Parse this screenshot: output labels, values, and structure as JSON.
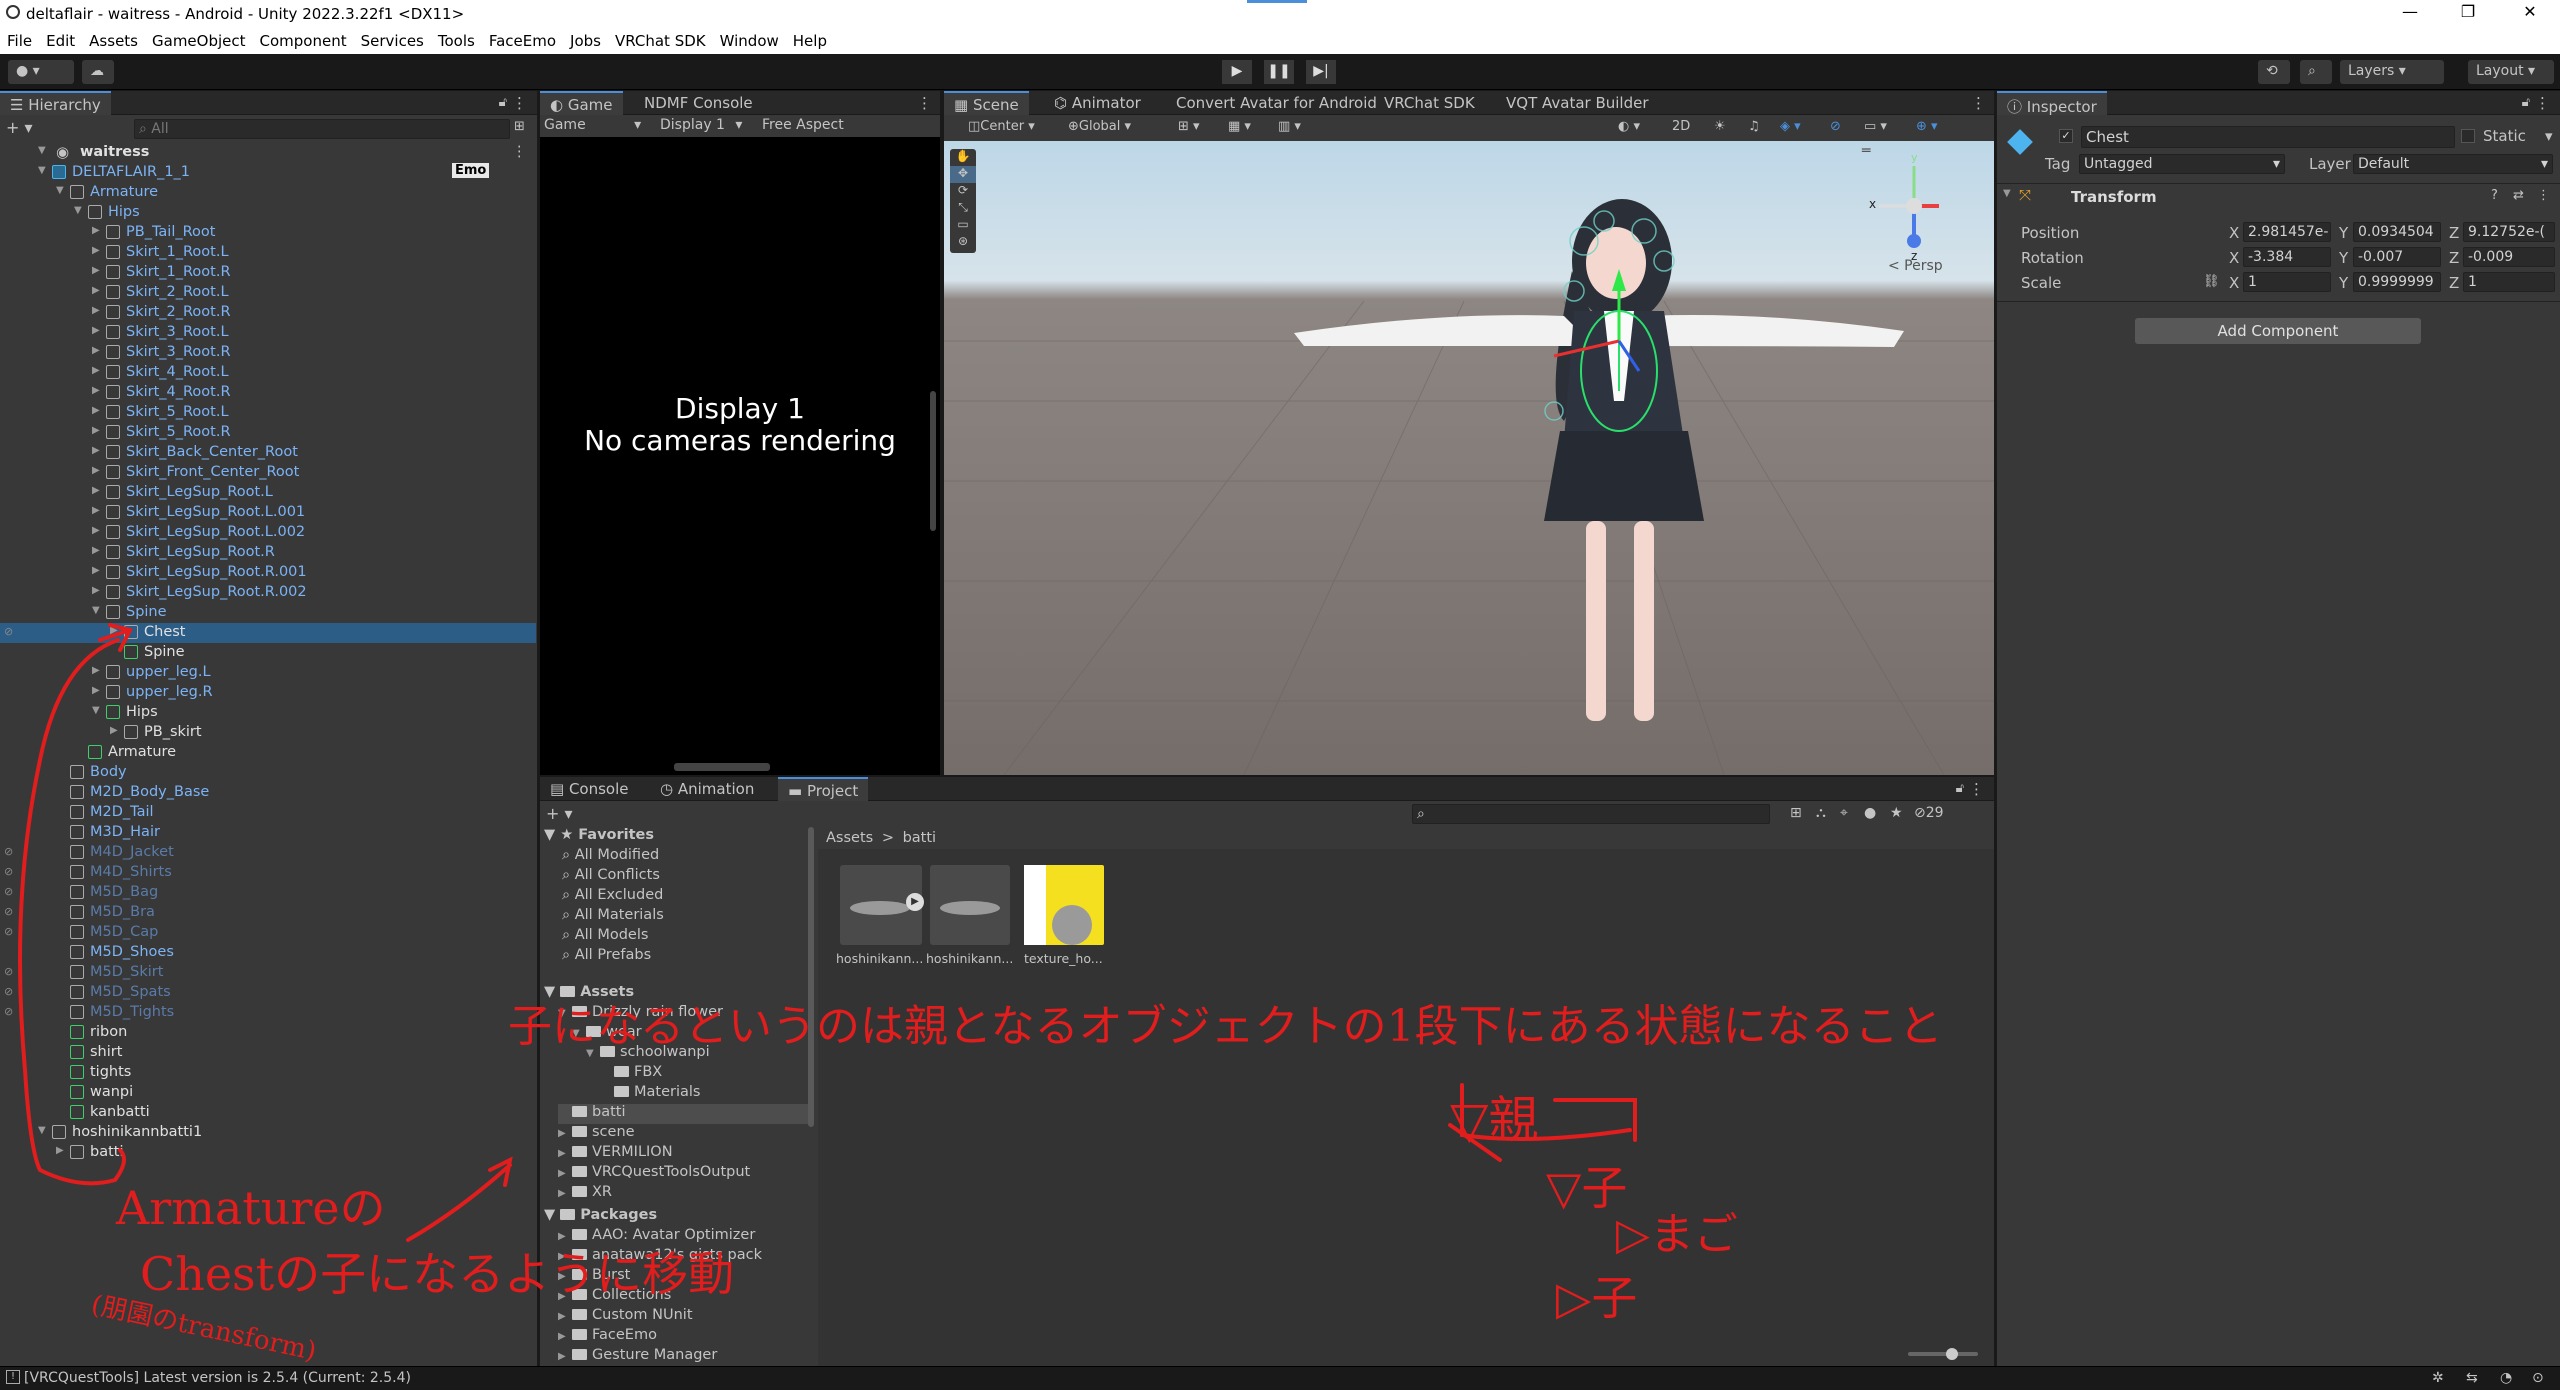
{
  "window": {
    "title": "deltaflair - waitress - Android - Unity 2022.3.22f1 <DX11>",
    "minimize": "—",
    "maximize": "❐",
    "close": "✕"
  },
  "menu": [
    "File",
    "Edit",
    "Assets",
    "GameObject",
    "Component",
    "Services",
    "Tools",
    "FaceEmo",
    "Jobs",
    "VRChat SDK",
    "Window",
    "Help"
  ],
  "toolbar": {
    "layers": "Layers",
    "layout": "Layout"
  },
  "hierarchy": {
    "tab": "Hierarchy",
    "search_placeholder": "All",
    "scene_name": "waitress",
    "emo_badge": "Emo",
    "rows": [
      {
        "label": "DELTAFLAIR_1_1",
        "depth": 1,
        "arrow": "▼",
        "icon": "blue",
        "color": "blue"
      },
      {
        "label": "Armature",
        "depth": 2,
        "arrow": "▼",
        "icon": "grey",
        "color": "blue"
      },
      {
        "label": "Hips",
        "depth": 3,
        "arrow": "▼",
        "icon": "grey",
        "color": "blue"
      },
      {
        "label": "PB_Tail_Root",
        "depth": 4,
        "arrow": "▶",
        "icon": "grey",
        "color": "blue"
      },
      {
        "label": "Skirt_1_Root.L",
        "depth": 4,
        "arrow": "▶",
        "icon": "grey",
        "color": "blue"
      },
      {
        "label": "Skirt_1_Root.R",
        "depth": 4,
        "arrow": "▶",
        "icon": "grey",
        "color": "blue"
      },
      {
        "label": "Skirt_2_Root.L",
        "depth": 4,
        "arrow": "▶",
        "icon": "grey",
        "color": "blue"
      },
      {
        "label": "Skirt_2_Root.R",
        "depth": 4,
        "arrow": "▶",
        "icon": "grey",
        "color": "blue"
      },
      {
        "label": "Skirt_3_Root.L",
        "depth": 4,
        "arrow": "▶",
        "icon": "grey",
        "color": "blue"
      },
      {
        "label": "Skirt_3_Root.R",
        "depth": 4,
        "arrow": "▶",
        "icon": "grey",
        "color": "blue"
      },
      {
        "label": "Skirt_4_Root.L",
        "depth": 4,
        "arrow": "▶",
        "icon": "grey",
        "color": "blue"
      },
      {
        "label": "Skirt_4_Root.R",
        "depth": 4,
        "arrow": "▶",
        "icon": "grey",
        "color": "blue"
      },
      {
        "label": "Skirt_5_Root.L",
        "depth": 4,
        "arrow": "▶",
        "icon": "grey",
        "color": "blue"
      },
      {
        "label": "Skirt_5_Root.R",
        "depth": 4,
        "arrow": "▶",
        "icon": "grey",
        "color": "blue"
      },
      {
        "label": "Skirt_Back_Center_Root",
        "depth": 4,
        "arrow": "▶",
        "icon": "grey",
        "color": "blue"
      },
      {
        "label": "Skirt_Front_Center_Root",
        "depth": 4,
        "arrow": "▶",
        "icon": "grey",
        "color": "blue"
      },
      {
        "label": "Skirt_LegSup_Root.L",
        "depth": 4,
        "arrow": "▶",
        "icon": "grey",
        "color": "blue"
      },
      {
        "label": "Skirt_LegSup_Root.L.001",
        "depth": 4,
        "arrow": "▶",
        "icon": "grey",
        "color": "blue"
      },
      {
        "label": "Skirt_LegSup_Root.L.002",
        "depth": 4,
        "arrow": "▶",
        "icon": "grey",
        "color": "blue"
      },
      {
        "label": "Skirt_LegSup_Root.R",
        "depth": 4,
        "arrow": "▶",
        "icon": "grey",
        "color": "blue"
      },
      {
        "label": "Skirt_LegSup_Root.R.001",
        "depth": 4,
        "arrow": "▶",
        "icon": "grey",
        "color": "blue"
      },
      {
        "label": "Skirt_LegSup_Root.R.002",
        "depth": 4,
        "arrow": "▶",
        "icon": "grey",
        "color": "blue"
      },
      {
        "label": "Spine",
        "depth": 4,
        "arrow": "▼",
        "icon": "grey",
        "color": "blue"
      },
      {
        "label": "Chest",
        "depth": 5,
        "arrow": "▶",
        "icon": "grey",
        "color": "white",
        "selected": true
      },
      {
        "label": "Spine",
        "depth": 5,
        "arrow": "",
        "icon": "green",
        "color": "white"
      },
      {
        "label": "upper_leg.L",
        "depth": 4,
        "arrow": "▶",
        "icon": "grey",
        "color": "blue"
      },
      {
        "label": "upper_leg.R",
        "depth": 4,
        "arrow": "▶",
        "icon": "grey",
        "color": "blue"
      },
      {
        "label": "Hips",
        "depth": 4,
        "arrow": "▼",
        "icon": "green",
        "color": "white"
      },
      {
        "label": "PB_skirt",
        "depth": 5,
        "arrow": "▶",
        "icon": "grey",
        "color": "white"
      },
      {
        "label": "Armature",
        "depth": 3,
        "arrow": "",
        "icon": "green",
        "color": "white"
      },
      {
        "label": "Body",
        "depth": 2,
        "arrow": "",
        "icon": "grey",
        "color": "blue"
      },
      {
        "label": "M2D_Body_Base",
        "depth": 2,
        "arrow": "",
        "icon": "grey",
        "color": "blue"
      },
      {
        "label": "M2D_Tail",
        "depth": 2,
        "arrow": "",
        "icon": "grey",
        "color": "blue"
      },
      {
        "label": "M3D_Hair",
        "depth": 2,
        "arrow": "",
        "icon": "grey",
        "color": "blue"
      },
      {
        "label": "M4D_Jacket",
        "depth": 2,
        "arrow": "",
        "icon": "grey",
        "color": "dim"
      },
      {
        "label": "M4D_Shirts",
        "depth": 2,
        "arrow": "",
        "icon": "grey",
        "color": "dim"
      },
      {
        "label": "M5D_Bag",
        "depth": 2,
        "arrow": "",
        "icon": "grey",
        "color": "dim"
      },
      {
        "label": "M5D_Bra",
        "depth": 2,
        "arrow": "",
        "icon": "grey",
        "color": "dim"
      },
      {
        "label": "M5D_Cap",
        "depth": 2,
        "arrow": "",
        "icon": "grey",
        "color": "dim"
      },
      {
        "label": "M5D_Shoes",
        "depth": 2,
        "arrow": "",
        "icon": "grey",
        "color": "blue"
      },
      {
        "label": "M5D_Skirt",
        "depth": 2,
        "arrow": "",
        "icon": "grey",
        "color": "dim"
      },
      {
        "label": "M5D_Spats",
        "depth": 2,
        "arrow": "",
        "icon": "grey",
        "color": "dim"
      },
      {
        "label": "M5D_Tights",
        "depth": 2,
        "arrow": "",
        "icon": "grey",
        "color": "dim"
      },
      {
        "label": "ribon",
        "depth": 2,
        "arrow": "",
        "icon": "green",
        "color": "white"
      },
      {
        "label": "shirt",
        "depth": 2,
        "arrow": "",
        "icon": "green",
        "color": "white"
      },
      {
        "label": "tights",
        "depth": 2,
        "arrow": "",
        "icon": "green",
        "color": "white"
      },
      {
        "label": "wanpi",
        "depth": 2,
        "arrow": "",
        "icon": "green",
        "color": "white"
      },
      {
        "label": "kanbatti",
        "depth": 2,
        "arrow": "",
        "icon": "green",
        "color": "white"
      },
      {
        "label": "hoshinikannbatti1",
        "depth": 1,
        "arrow": "▼",
        "icon": "grey",
        "color": "white"
      },
      {
        "label": "batti",
        "depth": 2,
        "arrow": "▶",
        "icon": "grey",
        "color": "white"
      }
    ]
  },
  "game": {
    "tabs": [
      "Game",
      "NDMF Console"
    ],
    "mode": "Game",
    "display": "Display 1",
    "aspect": "Free Aspect",
    "message_line1": "Display 1",
    "message_line2": "No cameras rendering"
  },
  "scene": {
    "tabs": [
      "Scene",
      "Animator",
      "Convert Avatar for Android",
      "VRChat SDK",
      "VQT Avatar Builder"
    ],
    "pivot": "Center",
    "space": "Global",
    "mode_2d": "2D",
    "persp": "< Persp",
    "gizmo_x": "x",
    "gizmo_z": "z",
    "gizmo_y": "y"
  },
  "inspector": {
    "tab": "Inspector",
    "object_name": "Chest",
    "static_label": "Static",
    "tag_label": "Tag",
    "tag_value": "Untagged",
    "layer_label": "Layer",
    "layer_value": "Default",
    "component": "Transform",
    "position_label": "Position",
    "rotation_label": "Rotation",
    "scale_label": "Scale",
    "pos_x": "2.981457e-",
    "pos_y": "0.0934504",
    "pos_z": "9.12752e-(",
    "rot_x": "-3.384",
    "rot_y": "-0.007",
    "rot_z": "-0.009",
    "scale_x": "1",
    "scale_y": "0.9999999",
    "scale_z": "1",
    "add_component": "Add Component",
    "axis_x": "X",
    "axis_y": "Y",
    "axis_z": "Z"
  },
  "bottom": {
    "tabs": [
      "Console",
      "Animation",
      "Project"
    ],
    "hidden_count": "29",
    "breadcrumb_root": "Assets",
    "breadcrumb_sep": ">",
    "breadcrumb_leaf": "batti",
    "favorites_title": "Favorites",
    "favorites": [
      "All Modified",
      "All Conflicts",
      "All Excluded",
      "All Materials",
      "All Models",
      "All Prefabs"
    ],
    "assets_title": "Assets",
    "asset_tree": [
      {
        "label": "Drizzly rain flower",
        "depth": 1,
        "arrow": "▼"
      },
      {
        "label": "wear",
        "depth": 2,
        "arrow": "▼"
      },
      {
        "label": "schoolwanpi",
        "depth": 3,
        "arrow": "▼"
      },
      {
        "label": "FBX",
        "depth": 4,
        "arrow": ""
      },
      {
        "label": "Materials",
        "depth": 4,
        "arrow": ""
      },
      {
        "label": "batti",
        "depth": 1,
        "arrow": "",
        "selected": true
      },
      {
        "label": "scene",
        "depth": 1,
        "arrow": "▶"
      },
      {
        "label": "VERMILION",
        "depth": 1,
        "arrow": "▶"
      },
      {
        "label": "VRCQuestToolsOutput",
        "depth": 1,
        "arrow": "▶"
      },
      {
        "label": "XR",
        "depth": 1,
        "arrow": "▶"
      }
    ],
    "packages_title": "Packages",
    "packages": [
      "AAO: Avatar Optimizer",
      "anatawa12's gists pack",
      "Burst",
      "Collections",
      "Custom NUnit",
      "FaceEmo",
      "Gesture Manager"
    ],
    "asset_items": [
      "hoshinikann...",
      "hoshinikann...",
      "texture_ho..."
    ]
  },
  "status": {
    "message": "[VRCQuestTools] Latest version is 2.5.4 (Current: 2.5.4)"
  },
  "annotations": {
    "armature_note": "Armatureの",
    "chest_note": "Chestの子になるように移動",
    "transform_note": "(朋園のtransform)",
    "main_note": "子になるというのは親となるオブジェクトの1段下にある状態になること",
    "tree_parent": "▽親",
    "tree_child1": "▽子",
    "tree_grandchild": "▷まご",
    "tree_child2": "▷子"
  },
  "colors": {
    "accent": "#2c5d87",
    "annotation": "#e11d1d",
    "prefab_blue": "#7cb3f5",
    "prefab_dim": "#5a7ba8"
  }
}
